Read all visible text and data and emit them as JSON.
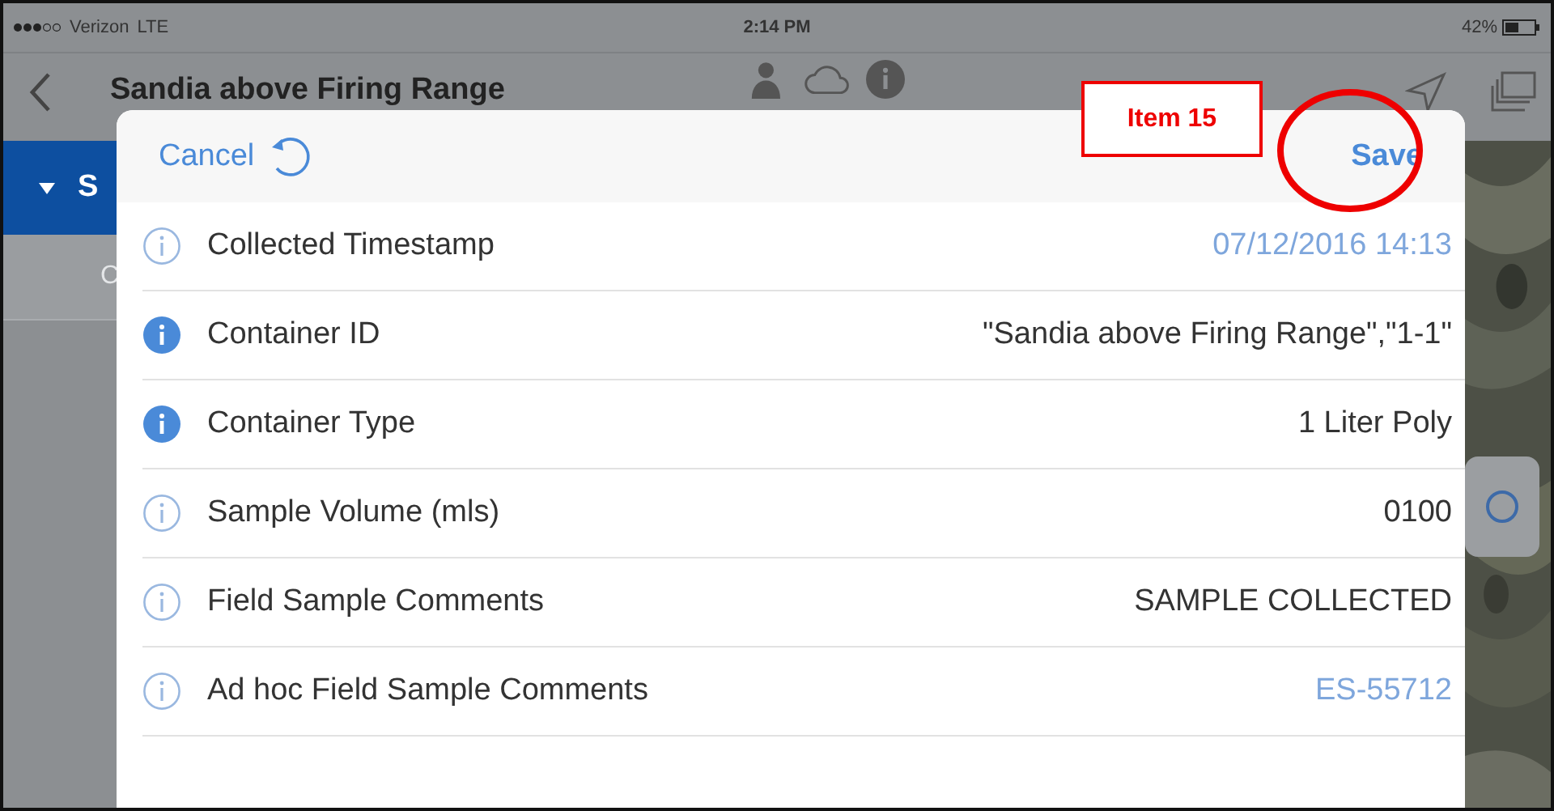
{
  "status_bar": {
    "carrier": "Verizon",
    "network": "LTE",
    "time": "2:14 PM",
    "battery": "42%"
  },
  "nav_bar": {
    "title": "Sandia above Firing Range"
  },
  "sidebar": {
    "section": "S",
    "row": "C"
  },
  "sheet": {
    "cancel": "Cancel",
    "save": "Save",
    "rows": [
      {
        "label": "Collected Timestamp",
        "value": "07/12/2016 14:13",
        "required": false,
        "highlighted": true
      },
      {
        "label": "Container ID",
        "value": "\"Sandia above Firing Range\",\"1-1\"",
        "required": true,
        "highlighted": false
      },
      {
        "label": "Container Type",
        "value": "1 Liter Poly",
        "required": true,
        "highlighted": false
      },
      {
        "label": "Sample Volume (mls)",
        "value": "0100",
        "required": false,
        "highlighted": false
      },
      {
        "label": "Field Sample Comments",
        "value": "SAMPLE COLLECTED",
        "required": false,
        "highlighted": false
      },
      {
        "label": "Ad hoc Field Sample Comments",
        "value": "ES-55712",
        "required": false,
        "highlighted": true
      }
    ]
  },
  "annotation": {
    "label": "Item 15"
  }
}
